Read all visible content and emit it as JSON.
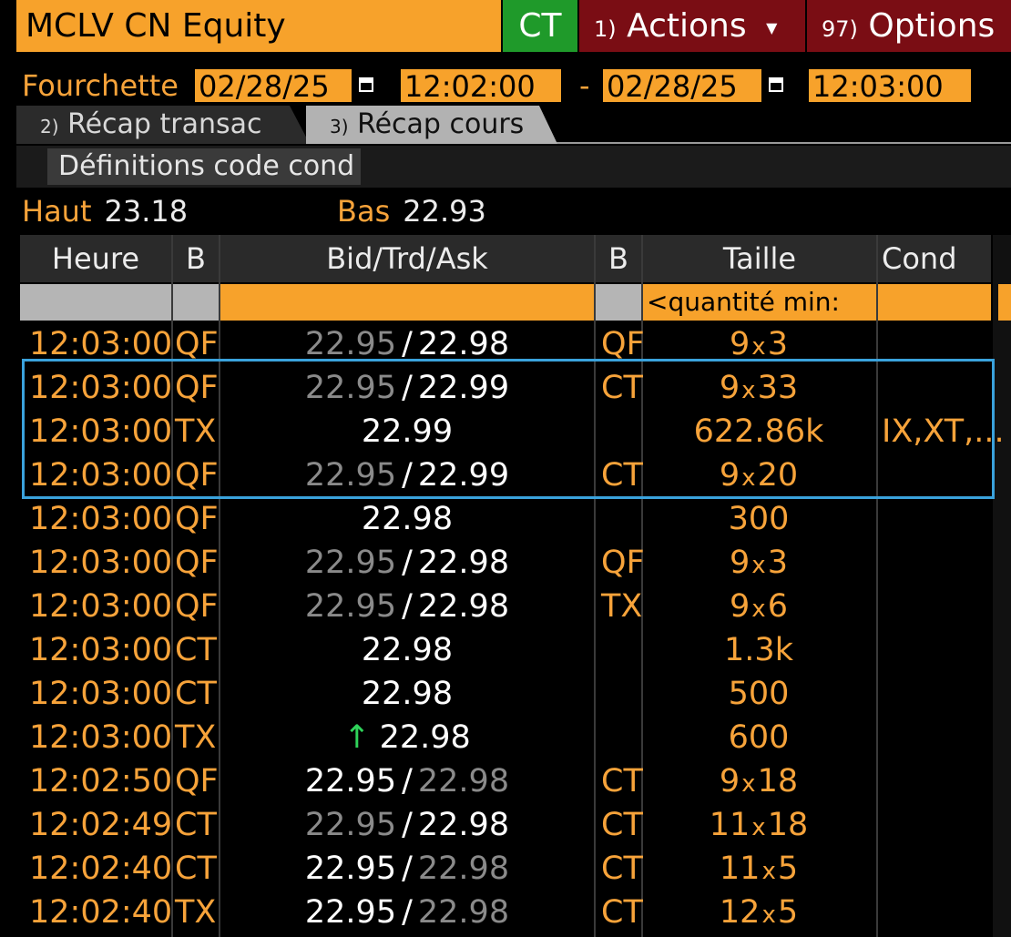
{
  "header": {
    "ticker": "MCLV CN Equity",
    "source": "CT",
    "actions_num": "1)",
    "actions_label": "Actions",
    "options_num": "97)",
    "options_label": "Options"
  },
  "range": {
    "label": "Fourchette",
    "start_date": "02/28/25",
    "start_time": "12:02:00",
    "separator": "-",
    "end_date": "02/28/25",
    "end_time": "12:03:00"
  },
  "tabs": [
    {
      "num": "2)",
      "label": "Récap transac"
    },
    {
      "num": "3)",
      "label": "Récap cours"
    }
  ],
  "definitions_button": "Définitions code cond",
  "stats": {
    "high_label": "Haut",
    "high": "23.18",
    "low_label": "Bas",
    "low": "22.93"
  },
  "table": {
    "headers": [
      "Heure",
      "B",
      "Bid/Trd/Ask",
      "B",
      "Taille",
      "Cond"
    ],
    "size_filter_placeholder": "<quantité min:",
    "rows": [
      {
        "time": "12:03:00",
        "b1": "QF",
        "bid": "22.95",
        "sep": "/",
        "ask": "22.98",
        "b2": "QF",
        "sz1": "9",
        "x": "x",
        "sz2": "3",
        "cond": ""
      },
      {
        "time": "12:03:00",
        "b1": "QF",
        "bid": "22.95",
        "sep": "/",
        "ask": "22.99",
        "b2": "CT",
        "sz1": "9",
        "x": "x",
        "sz2": "33",
        "cond": ""
      },
      {
        "time": "12:03:00",
        "b1": "TX",
        "trade": "22.99",
        "size": "622.86k",
        "cond": "IX,XT,..."
      },
      {
        "time": "12:03:00",
        "b1": "QF",
        "bid": "22.95",
        "sep": "/",
        "ask": "22.99",
        "b2": "CT",
        "sz1": "9",
        "x": "x",
        "sz2": "20",
        "cond": ""
      },
      {
        "time": "12:03:00",
        "b1": "QF",
        "trade": "22.98",
        "size": "300",
        "cond": ""
      },
      {
        "time": "12:03:00",
        "b1": "QF",
        "bid": "22.95",
        "sep": "/",
        "ask": "22.98",
        "b2": "QF",
        "sz1": "9",
        "x": "x",
        "sz2": "3",
        "cond": ""
      },
      {
        "time": "12:03:00",
        "b1": "QF",
        "bid": "22.95",
        "sep": "/",
        "ask": "22.98",
        "b2": "TX",
        "sz1": "9",
        "x": "x",
        "sz2": "6",
        "cond": ""
      },
      {
        "time": "12:03:00",
        "b1": "CT",
        "trade": "22.98",
        "size": "1.3k",
        "cond": ""
      },
      {
        "time": "12:03:00",
        "b1": "CT",
        "trade": "22.98",
        "size": "500",
        "cond": ""
      },
      {
        "time": "12:03:00",
        "b1": "TX",
        "arrow": "↑",
        "trade": "22.98",
        "size": "600",
        "cond": ""
      },
      {
        "time": "12:02:50",
        "b1": "QF",
        "bid": "22.95",
        "sep": "/",
        "ask": "22.98",
        "b2": "CT",
        "sz1": "9",
        "x": "x",
        "sz2": "18",
        "cond": ""
      },
      {
        "time": "12:02:49",
        "b1": "CT",
        "bid": "22.95",
        "sep": "/",
        "ask": "22.98",
        "b2": "CT",
        "sz1": "11",
        "x": "x",
        "sz2": "18",
        "cond": ""
      },
      {
        "time": "12:02:40",
        "b1": "CT",
        "bid": "22.95",
        "sep": "/",
        "ask": "22.98",
        "b2": "CT",
        "sz1": "11",
        "x": "x",
        "sz2": "5",
        "cond": ""
      },
      {
        "time": "12:02:40",
        "b1": "TX",
        "bid": "22.95",
        "sep": "/",
        "ask": "22.98",
        "b2": "CT",
        "sz1": "12",
        "x": "x",
        "sz2": "5",
        "cond": ""
      }
    ]
  },
  "colors": {
    "accent_orange": "#f7a22b",
    "source_green": "#1f9a2a",
    "menu_red": "#7a0d14",
    "highlight_blue": "#3aa2dc",
    "uptick_green": "#2fd35a"
  }
}
